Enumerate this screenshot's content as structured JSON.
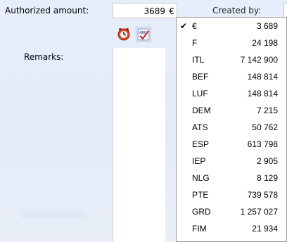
{
  "form": {
    "authorized_amount_label": "Authorized amount:",
    "created_by_label": "Created by:",
    "remarks_label": "Remarks:",
    "amount_value": "3689",
    "amount_currency": "€"
  },
  "toolbar": {
    "clock_icon": "alarm-clock-icon",
    "spell_icon": "spellcheck-icon"
  },
  "currency_menu": {
    "items": [
      {
        "code": "€",
        "value": "3 689",
        "checked": true
      },
      {
        "code": "F",
        "value": "24 198"
      },
      {
        "code": "ITL",
        "value": "7 142 900"
      },
      {
        "code": "BEF",
        "value": "148 814"
      },
      {
        "code": "LUF",
        "value": "148 814"
      },
      {
        "code": "DEM",
        "value": "7 215"
      },
      {
        "code": "ATS",
        "value": "50 762"
      },
      {
        "code": "ESP",
        "value": "613 798"
      },
      {
        "code": "IEP",
        "value": "2 905"
      },
      {
        "code": "NLG",
        "value": "8 129"
      },
      {
        "code": "PTE",
        "value": "739 578"
      },
      {
        "code": "GRD",
        "value": "1 257 027"
      },
      {
        "code": "FIM",
        "value": "21 934"
      }
    ],
    "check_mark": "✔"
  },
  "colors": {
    "form_bg": "#e5ecf9",
    "menu_border": "#999999"
  }
}
